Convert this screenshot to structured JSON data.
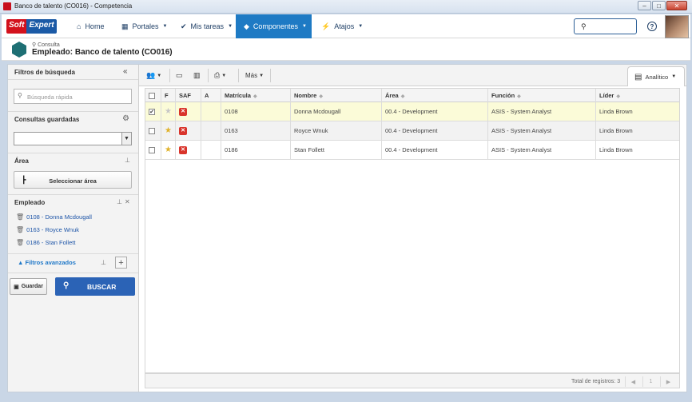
{
  "window": {
    "title": "Banco de talento (CO016) - Competencia"
  },
  "logo": {
    "soft": "Soft",
    "expert": "Expert"
  },
  "nav": {
    "home": "Home",
    "portales": "Portales",
    "mis_tareas": "Mis tareas",
    "componentes": "Componentes",
    "atajos": "Atajos"
  },
  "header": {
    "breadcrumb": "Consulta",
    "title": "Empleado: Banco de talento (CO016)"
  },
  "filters": {
    "title": "Filtros de búsqueda",
    "quick_placeholder": "Búsqueda rápida",
    "saved_label": "Consultas guardadas",
    "area_label": "Área",
    "area_button": "Seleccionar área",
    "employee_label": "Empleado",
    "employees": [
      "0108 - Donna Mcdougall",
      "0163 - Royce Wnuk",
      "0186 - Stan Follett"
    ],
    "advanced": "Filtros avanzados",
    "save_button": "Guardar",
    "search_button": "BUSCAR"
  },
  "toolbar": {
    "mas": "Más",
    "view": "Analítico"
  },
  "table": {
    "headers": {
      "f": "F",
      "saf": "SAF",
      "a": "A",
      "matricula": "Matrícula",
      "nombre": "Nombre",
      "area": "Área",
      "funcion": "Función",
      "lider": "Líder"
    },
    "rows": [
      {
        "checked": true,
        "starred": false,
        "matricula": "0108",
        "nombre": "Donna Mcdougall",
        "area": "00.4 - Development",
        "funcion": "ASIS - System Analyst",
        "lider": "Linda Brown"
      },
      {
        "checked": false,
        "starred": true,
        "matricula": "0163",
        "nombre": "Royce Wnuk",
        "area": "00.4 - Development",
        "funcion": "ASIS - System Analyst",
        "lider": "Linda Brown"
      },
      {
        "checked": false,
        "starred": true,
        "matricula": "0186",
        "nombre": "Stan Follett",
        "area": "00.4 - Development",
        "funcion": "ASIS - System Analyst",
        "lider": "Linda Brown"
      }
    ],
    "total": "Total de registros: 3",
    "page": "1"
  },
  "colors": {
    "accent": "#1e7ac4",
    "search_button": "#2b63b6",
    "selected_row": "#fbfbd8",
    "star": "#e0b22b",
    "saf": "#d9342b"
  }
}
